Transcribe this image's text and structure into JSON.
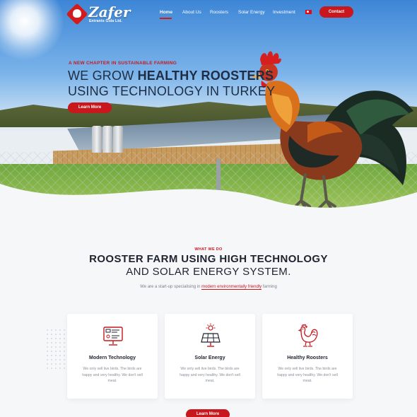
{
  "brand": {
    "name": "Zafer",
    "subtitle": "Entrants Gıda Ltd."
  },
  "nav": {
    "items": [
      "Home",
      "About Us",
      "Roosters",
      "Solar Energy",
      "Investment"
    ],
    "active": "Home",
    "contact_label": "Contact",
    "flag_icon": "turkey-flag-icon"
  },
  "hero": {
    "kicker": "A NEW CHAPTER IN SUSTAINABLE FARMING",
    "title_line1_prefix": "WE GROW ",
    "title_line1_bold": "HEALTHY ROOSTERS",
    "title_line2": "USING TECHNOLOGY IN TURKEY",
    "button_label": "Learn More"
  },
  "section": {
    "kicker": "WHAT WE DO",
    "title_line1": "ROOSTER FARM USING HIGH TECHNOLOGY",
    "title_line2": "AND SOLAR ENERGY SYSTEM.",
    "desc_prefix": "We are a start-up specialising in ",
    "desc_highlight": "modern environmentally friendly",
    "desc_suffix": " farming",
    "button_label": "Learn More"
  },
  "cards": [
    {
      "icon": "monitor-icon",
      "title": "Modern Technology",
      "body": "We only sell live birds. The birds are happy and very healthy. We don't sell meat."
    },
    {
      "icon": "solar-panel-icon",
      "title": "Solar Energy",
      "body": "We only sell live birds. The birds are happy and very healthy. We don't sell meat."
    },
    {
      "icon": "rooster-icon",
      "title": "Healthy Roosters",
      "body": "We only sell live birds. The birds are happy and very healthy. We don't sell meat."
    }
  ],
  "colors": {
    "accent": "#c8171d",
    "heading": "#1e2d44",
    "background": "#f6f7f9"
  }
}
